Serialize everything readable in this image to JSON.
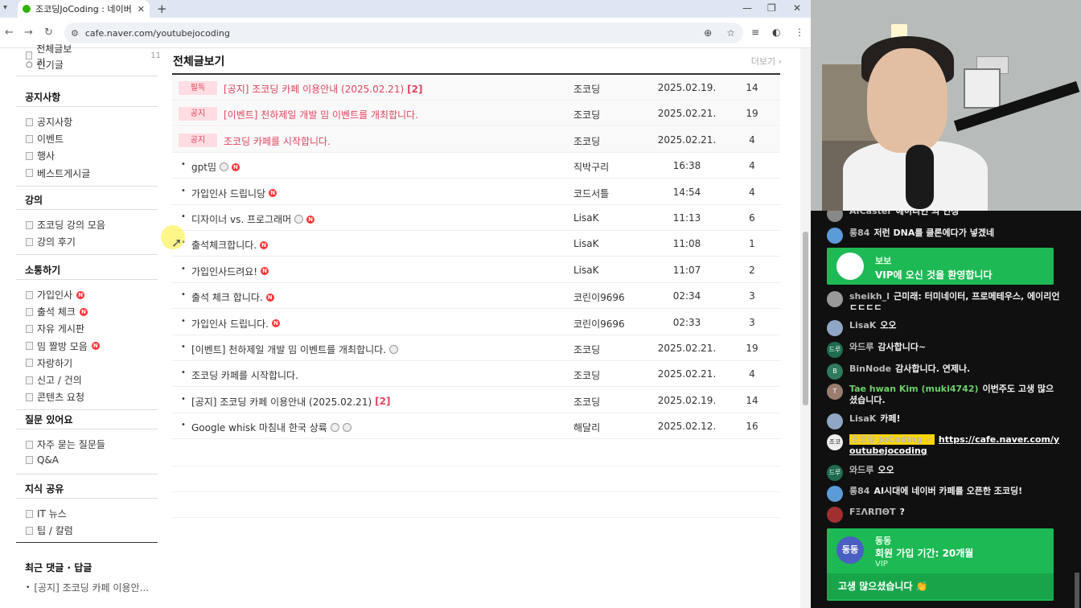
{
  "browser": {
    "tab_title": "조코딩JoCoding : 네이버 카페",
    "url": "cafe.naver.com/youtubejocoding",
    "new_tab": "+",
    "close": "✕"
  },
  "sidebar": {
    "top_items": [
      {
        "label": "전체글보기",
        "count": "11"
      },
      {
        "label": "인기글"
      }
    ],
    "sections": [
      {
        "title": "공지사항",
        "items": [
          {
            "label": "공지사항"
          },
          {
            "label": "이벤트"
          },
          {
            "label": "행사"
          },
          {
            "label": "베스트게시글"
          }
        ]
      },
      {
        "title": "강의",
        "items": [
          {
            "label": "조코딩 강의 모음"
          },
          {
            "label": "강의 후기"
          }
        ]
      },
      {
        "title": "소통하기",
        "items": [
          {
            "label": "가입인사",
            "new": true
          },
          {
            "label": "출석 체크",
            "new": true
          },
          {
            "label": "자유 게시판"
          },
          {
            "label": "밈 짤방 모음",
            "new": true
          },
          {
            "label": "자랑하기"
          },
          {
            "label": "신고 / 건의"
          },
          {
            "label": "콘텐츠 요청"
          }
        ]
      },
      {
        "title": "질문 있어요",
        "items": [
          {
            "label": "자주 묻는 질문들"
          },
          {
            "label": "Q&A"
          }
        ]
      },
      {
        "title": "지식 공유",
        "items": [
          {
            "label": "IT 뉴스"
          },
          {
            "label": "팁 / 칼럼"
          }
        ]
      }
    ],
    "recent_title": "최근 댓글 · 답글",
    "recent_item": "[공지] 조코딩 카페 이용안..."
  },
  "board": {
    "title": "전체글보기",
    "more": "더보기 ›",
    "new_badge": "N",
    "posts": [
      {
        "badge": "필독",
        "title": "[공지] 조코딩 카페 이용안내 (2025.02.21)",
        "comments": "[2]",
        "author": "조코딩",
        "date": "2025.02.19.",
        "views": "14"
      },
      {
        "badge": "공지",
        "title": "[이벤트] 천하제일 개발 밈 이벤트를 개최합니다.",
        "author": "조코딩",
        "date": "2025.02.21.",
        "views": "19"
      },
      {
        "badge": "공지",
        "title": "조코딩 카페를 시작합니다.",
        "author": "조코딩",
        "date": "2025.02.21.",
        "views": "4"
      },
      {
        "title": "gpt밈",
        "emoji": true,
        "new": true,
        "author": "직박구리",
        "date": "16:38",
        "views": "4"
      },
      {
        "title": "가입인사 드립니당",
        "new": true,
        "author": "코드서틀",
        "date": "14:54",
        "views": "4"
      },
      {
        "title": "디자이너 vs. 프로그래머",
        "emoji": true,
        "new": true,
        "author": "LisaK",
        "date": "11:13",
        "views": "6"
      },
      {
        "title": "출석체크합니다.",
        "new": true,
        "author": "LisaK",
        "date": "11:08",
        "views": "1"
      },
      {
        "title": "가입인사드려요!",
        "new": true,
        "author": "LisaK",
        "date": "11:07",
        "views": "2"
      },
      {
        "title": "출석 체크 합니다.",
        "new": true,
        "author": "코린이9696",
        "date": "02:34",
        "views": "3"
      },
      {
        "title": "가입인사 드립니다.",
        "new": true,
        "author": "코린이9696",
        "date": "02:33",
        "views": "3"
      },
      {
        "title": "[이벤트] 천하제일 개발 밈 이벤트를 개최합니다.",
        "emoji": true,
        "author": "조코딩",
        "date": "2025.02.21.",
        "views": "19"
      },
      {
        "title": "조코딩 카페를 시작합니다.",
        "author": "조코딩",
        "date": "2025.02.21.",
        "views": "4"
      },
      {
        "title": "[공지] 조코딩 카페 이용안내 (2025.02.21)",
        "comments": "[2]",
        "author": "조코딩",
        "date": "2025.02.19.",
        "views": "14"
      },
      {
        "title": "Google whisk 마침내 한국 상륙",
        "emoji": true,
        "emoji2": true,
        "author": "해달리",
        "date": "2025.02.12.",
        "views": "16"
      }
    ]
  },
  "chat": {
    "messages": [
      {
        "name": "AICaster",
        "text": "에이디인 의 인정",
        "avatar_color": "#888888"
      },
      {
        "name": "롱84",
        "text": "저런 DNA를 클론에다가 넣겠네",
        "avatar_color": "#5a9bd8"
      },
      {
        "name": "sheikh_l",
        "text": "근미래: 터미네이터, 프로메테우스, 에이리언 ㄷㄷㄷㄷ",
        "avatar_color": "#999999"
      },
      {
        "name": "LisaK",
        "text": "오오",
        "avatar_color": "#8fa7c5"
      },
      {
        "name": "와드루",
        "avatar_text": "드루",
        "text": "감사합니다~",
        "avatar_color": "#1f6b4f"
      },
      {
        "name": "BinNode",
        "avatar_text": "B",
        "text": "감사합니다. 연제나.",
        "avatar_color": "#2f7b5b"
      },
      {
        "name": "Tae hwan Kim (muki4742)",
        "avatar_text": "T",
        "text": "이번주도 고생 많으셨습니다.",
        "avatar_color": "#9b7d6d",
        "green": true
      },
      {
        "name": "LisaK",
        "text": "카페!",
        "avatar_color": "#8fa7c5"
      },
      {
        "name": "조코딩 JoCoding ✓",
        "avatar_text": "조코",
        "link": "https://cafe.naver.com/youtubejocoding",
        "avatar_color": "#eeeeee",
        "owner": true
      },
      {
        "name": "와드루",
        "avatar_text": "드루",
        "text": "오오",
        "avatar_color": "#1f6b4f"
      },
      {
        "name": "롱84",
        "text": "AI시대에 네이버 카페를 오픈한 조코딩!",
        "avatar_color": "#5a9bd8"
      },
      {
        "name": "FΞΛRΠΘT",
        "text": "?",
        "avatar_color": "#a03030"
      }
    ],
    "vip1": {
      "name": "보보",
      "message": "VIP에 오신 것을 환영합니다"
    },
    "vip2": {
      "name": "동동",
      "avatar_text": "동동",
      "message": "회원 가입 기간: 20개월",
      "tier": "VIP",
      "bottom": "고생 많으셨습니다 👏"
    }
  },
  "colors": {
    "accent": "#e1445f",
    "notice_badge_bg": "#ffdde2",
    "membership_green": "#1db954"
  }
}
